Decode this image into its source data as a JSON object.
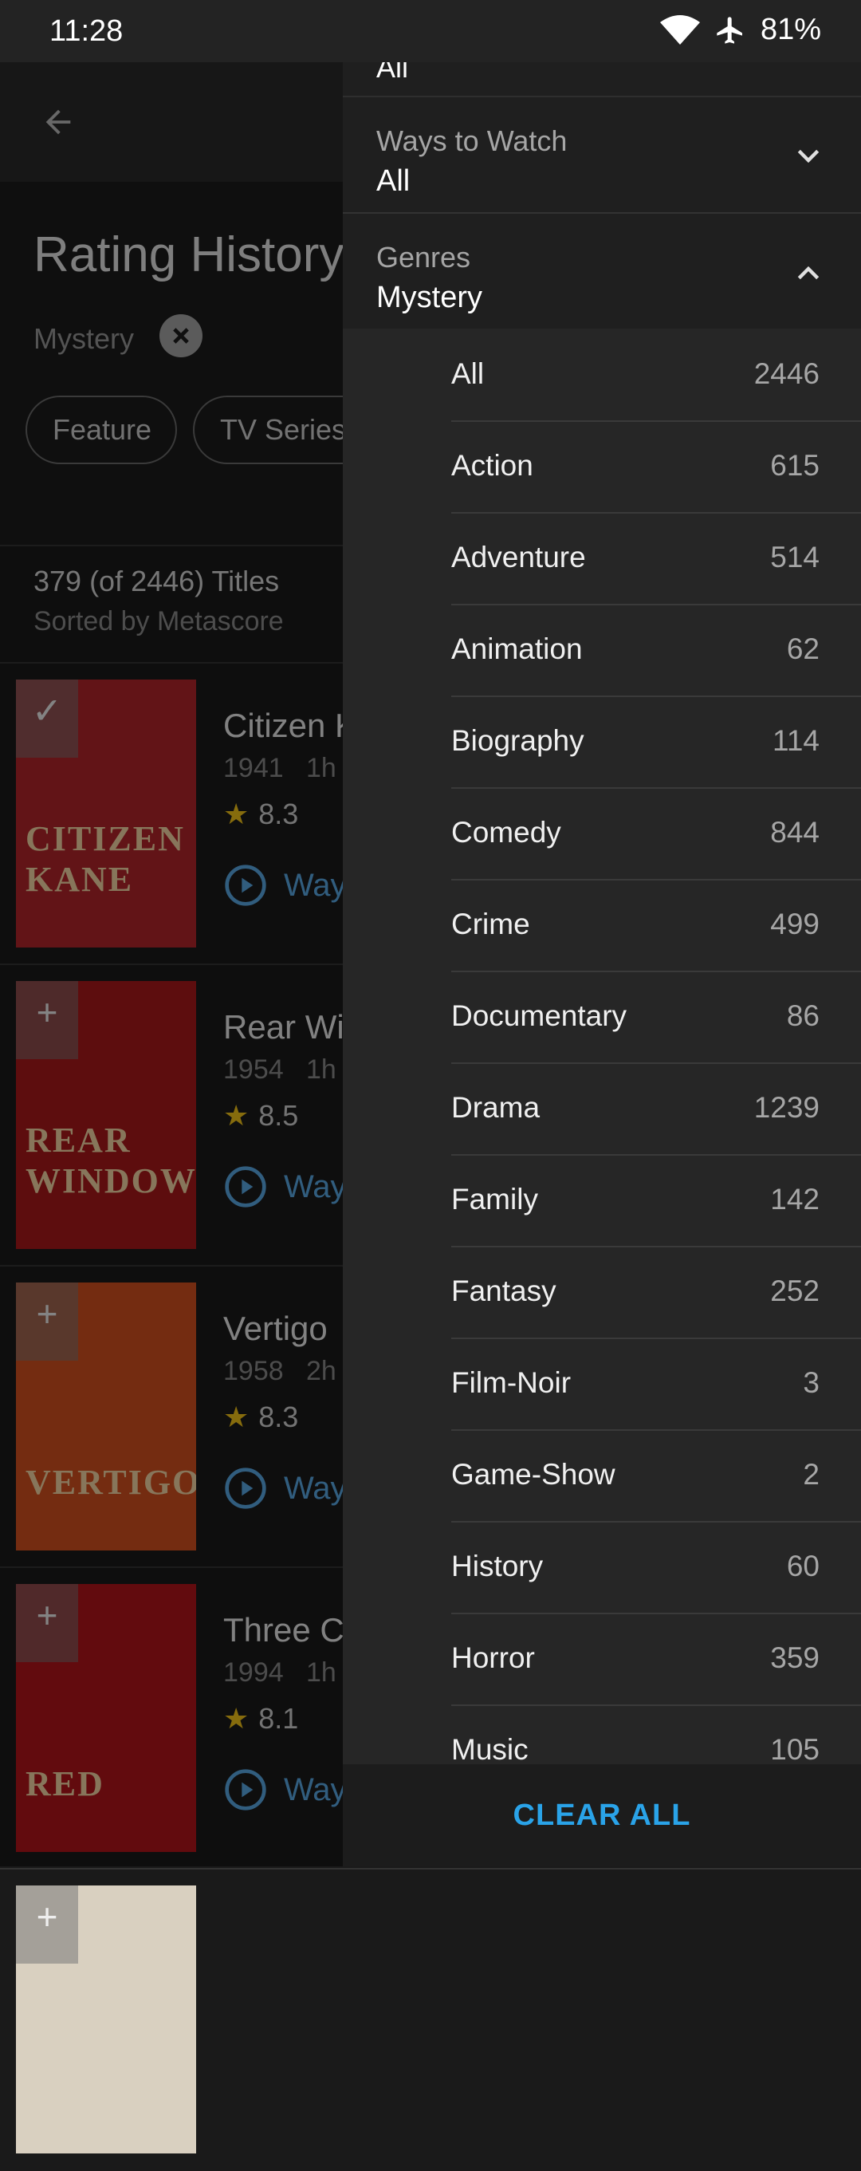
{
  "status_bar": {
    "time": "11:28",
    "battery": "81%",
    "icons": [
      "wifi-icon",
      "airplane-icon"
    ]
  },
  "page": {
    "title": "Rating History",
    "active_filter": "Mystery",
    "pills": [
      "Feature",
      "TV Series"
    ],
    "titles_count": "379 (of 2446) Titles",
    "sorted_by": "Sorted by Metascore"
  },
  "movies": [
    {
      "title": "Citizen K",
      "year": "1941",
      "runtime": "1h",
      "rating": "8.3",
      "watch": "Way",
      "poster_text": "CITIZEN KANE",
      "poster_color": "#b3262b",
      "badge": "✓"
    },
    {
      "title": "Rear Wir",
      "year": "1954",
      "runtime": "1h",
      "rating": "8.5",
      "watch": "Way",
      "poster_text": "REAR WINDOW",
      "poster_color": "#a9191b",
      "badge": "+"
    },
    {
      "title": "Vertigo",
      "year": "1958",
      "runtime": "2h",
      "rating": "8.3",
      "watch": "Way",
      "poster_text": "VERTIGO",
      "poster_color": "#d4511f",
      "badge": "+"
    },
    {
      "title": "Three Co",
      "year": "1994",
      "runtime": "1h",
      "rating": "8.1",
      "watch": "Way",
      "poster_text": "RED",
      "poster_color": "#b2151b",
      "badge": "+"
    }
  ],
  "drawer": {
    "top_partial": "All",
    "ways_to_watch": {
      "label": "Ways to Watch",
      "value": "All"
    },
    "genres": {
      "label": "Genres",
      "value": "Mystery"
    },
    "genre_items": [
      {
        "name": "All",
        "count": "2446"
      },
      {
        "name": "Action",
        "count": "615"
      },
      {
        "name": "Adventure",
        "count": "514"
      },
      {
        "name": "Animation",
        "count": "62"
      },
      {
        "name": "Biography",
        "count": "114"
      },
      {
        "name": "Comedy",
        "count": "844"
      },
      {
        "name": "Crime",
        "count": "499"
      },
      {
        "name": "Documentary",
        "count": "86"
      },
      {
        "name": "Drama",
        "count": "1239"
      },
      {
        "name": "Family",
        "count": "142"
      },
      {
        "name": "Fantasy",
        "count": "252"
      },
      {
        "name": "Film-Noir",
        "count": "3"
      },
      {
        "name": "Game-Show",
        "count": "2"
      },
      {
        "name": "History",
        "count": "60"
      },
      {
        "name": "Horror",
        "count": "359"
      },
      {
        "name": "Music",
        "count": "105"
      }
    ],
    "clear_all": "CLEAR ALL"
  },
  "colors": {
    "accent": "#2aa3e8",
    "star": "#f5c518",
    "drawer_bg": "#1f1f1f"
  }
}
